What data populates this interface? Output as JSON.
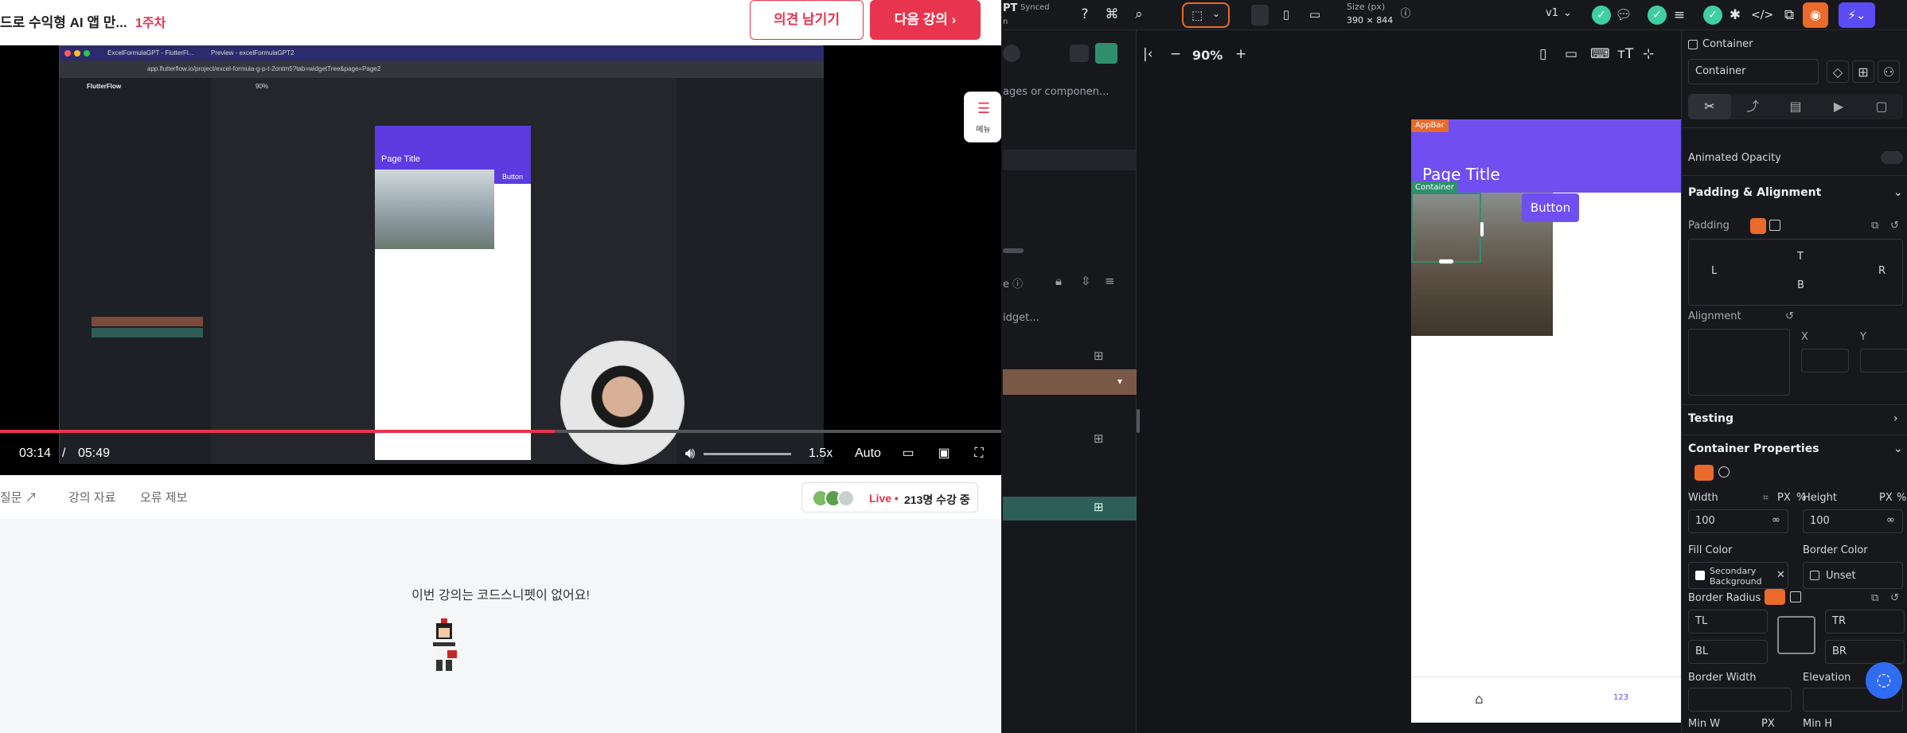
{
  "course": {
    "title": "드로 수익형 AI 앱 만...",
    "week": "1주차"
  },
  "actions": {
    "feedback": "의견 남기기",
    "next": "다음 강의 ›"
  },
  "video": {
    "current_time": "03:14",
    "separator": "/",
    "duration": "05:49",
    "progress": 0.554,
    "speed": "1.5x",
    "quality": "Auto",
    "inner": {
      "app_name": "FlutterFlow",
      "tab1": "ExcelFormulaGPT - FlutterFl...",
      "tab2": "Preview - excelFormulaGPT2",
      "url": "app.flutterflow.io/project/excel-formula-g-p-t-2ontm5?tab=widgetTree&page=Page2",
      "page_title": "Page Title",
      "button": "Button",
      "zoom": "90%"
    }
  },
  "menu_float": {
    "label": "메뉴"
  },
  "tabs": [
    {
      "label": "질문 ↗"
    },
    {
      "label": "강의 자료"
    },
    {
      "label": "오류 제보"
    }
  ],
  "live": {
    "label": "Live •",
    "count": "213명 수강 중"
  },
  "snippet": {
    "empty": "이번 강의는 코드스니펫이 없어요!"
  },
  "ff": {
    "header": {
      "project_short": "PT",
      "synced": "Synced",
      "sub": "n",
      "size_label": "Size (px)",
      "size_value": "390 × 844",
      "version": "v1"
    },
    "left": {
      "search": "ages or componen...",
      "widget_search": "idget..."
    },
    "canvas": {
      "zoom": "90%",
      "appbar_tag": "AppBar",
      "page_title": "Page Title",
      "container_tag": "Container",
      "button": "Button"
    },
    "right": {
      "widget_type": "Container",
      "widget_name": "Container",
      "animated_opacity": "Animated Opacity",
      "padding_section": "Padding & Alignment",
      "padding": "Padding",
      "pad_L": "L",
      "pad_T": "T",
      "pad_R": "R",
      "pad_B": "B",
      "alignment": "Alignment",
      "x": "X",
      "y": "Y",
      "testing": "Testing",
      "container_props": "Container Properties",
      "width": "Width",
      "height": "Height",
      "unit": "PX",
      "pct": "%",
      "width_val": "100",
      "height_val": "100",
      "fill_color": "Fill Color",
      "fill_value": "Secondary Background",
      "border_color": "Border Color",
      "border_value": "Unset",
      "border_radius": "Border Radius",
      "tl": "TL",
      "tr": "TR",
      "bl": "BL",
      "br": "BR",
      "border_width": "Border Width",
      "elevation": "Elevation",
      "min_w": "Min W",
      "min_h": "Min H"
    }
  },
  "colors": {
    "brand": "#e8344e",
    "ff_accent": "#e96a2b",
    "ff_purple": "#6f4ff0",
    "ff_green": "#3fcfa0"
  }
}
